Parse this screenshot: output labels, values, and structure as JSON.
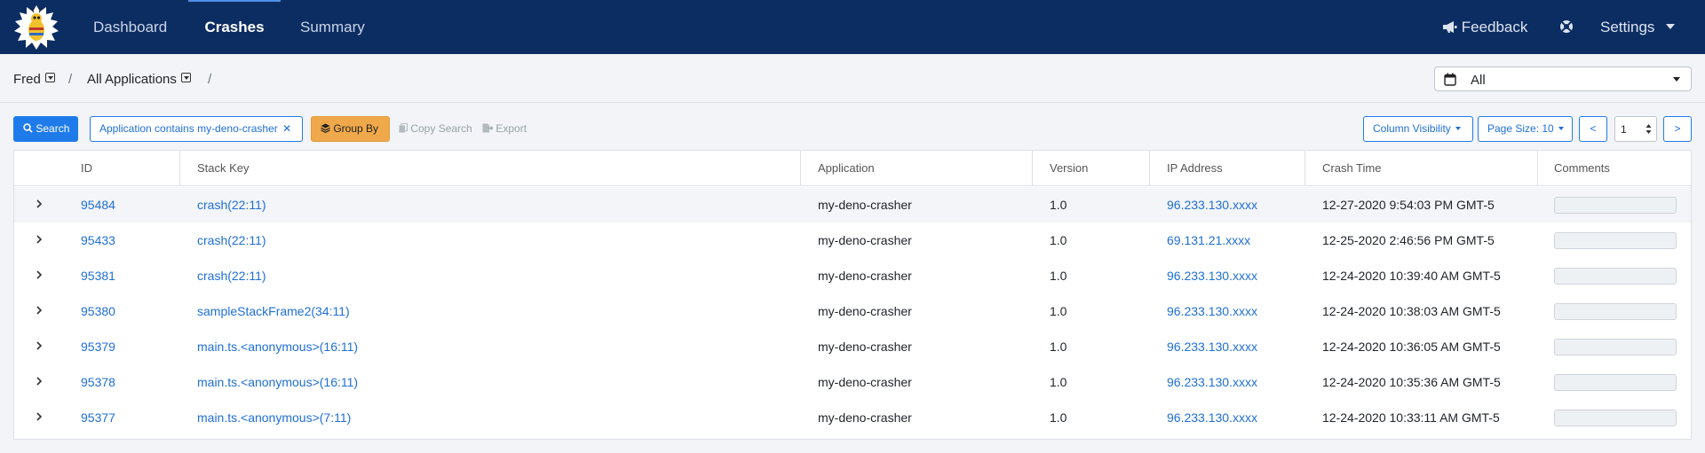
{
  "nav": {
    "items": [
      "Dashboard",
      "Crashes",
      "Summary"
    ],
    "active": "Crashes",
    "feedback": "Feedback",
    "settings": "Settings"
  },
  "breadcrumb": {
    "user": "Fred",
    "sep1": "/",
    "app": "All Applications",
    "sep2": "/"
  },
  "date_filter": {
    "value": "All"
  },
  "toolbar": {
    "search": "Search",
    "filter": "Application contains my-deno-crasher",
    "group_by": "Group By",
    "copy_search": "Copy Search",
    "export": "Export",
    "column_visibility": "Column Visibility",
    "page_size": "Page Size: 10",
    "prev": "<",
    "page": "1",
    "next": ">"
  },
  "table": {
    "columns": [
      "ID",
      "Stack Key",
      "Application",
      "Version",
      "IP Address",
      "Crash Time",
      "Comments"
    ],
    "rows": [
      {
        "id": "95484",
        "stack_key": "crash(22:11)",
        "application": "my-deno-crasher",
        "version": "1.0",
        "ip": "96.233.130.xxxx",
        "time": "12-27-2020 9:54:03 PM GMT-5"
      },
      {
        "id": "95433",
        "stack_key": "crash(22:11)",
        "application": "my-deno-crasher",
        "version": "1.0",
        "ip": "69.131.21.xxxx",
        "time": "12-25-2020 2:46:56 PM GMT-5"
      },
      {
        "id": "95381",
        "stack_key": "crash(22:11)",
        "application": "my-deno-crasher",
        "version": "1.0",
        "ip": "96.233.130.xxxx",
        "time": "12-24-2020 10:39:40 AM GMT-5"
      },
      {
        "id": "95380",
        "stack_key": "sampleStackFrame2(34:11)",
        "application": "my-deno-crasher",
        "version": "1.0",
        "ip": "96.233.130.xxxx",
        "time": "12-24-2020 10:38:03 AM GMT-5"
      },
      {
        "id": "95379",
        "stack_key": "main.ts.<anonymous>(16:11)",
        "application": "my-deno-crasher",
        "version": "1.0",
        "ip": "96.233.130.xxxx",
        "time": "12-24-2020 10:36:05 AM GMT-5"
      },
      {
        "id": "95378",
        "stack_key": "main.ts.<anonymous>(16:11)",
        "application": "my-deno-crasher",
        "version": "1.0",
        "ip": "96.233.130.xxxx",
        "time": "12-24-2020 10:35:36 AM GMT-5"
      },
      {
        "id": "95377",
        "stack_key": "main.ts.<anonymous>(7:11)",
        "application": "my-deno-crasher",
        "version": "1.0",
        "ip": "96.233.130.xxxx",
        "time": "12-24-2020 10:33:11 AM GMT-5"
      }
    ]
  },
  "colors": {
    "navbar": "#0c2d62",
    "primary": "#1f7bea",
    "warning": "#f0a94a",
    "link": "#1f6fd6"
  }
}
